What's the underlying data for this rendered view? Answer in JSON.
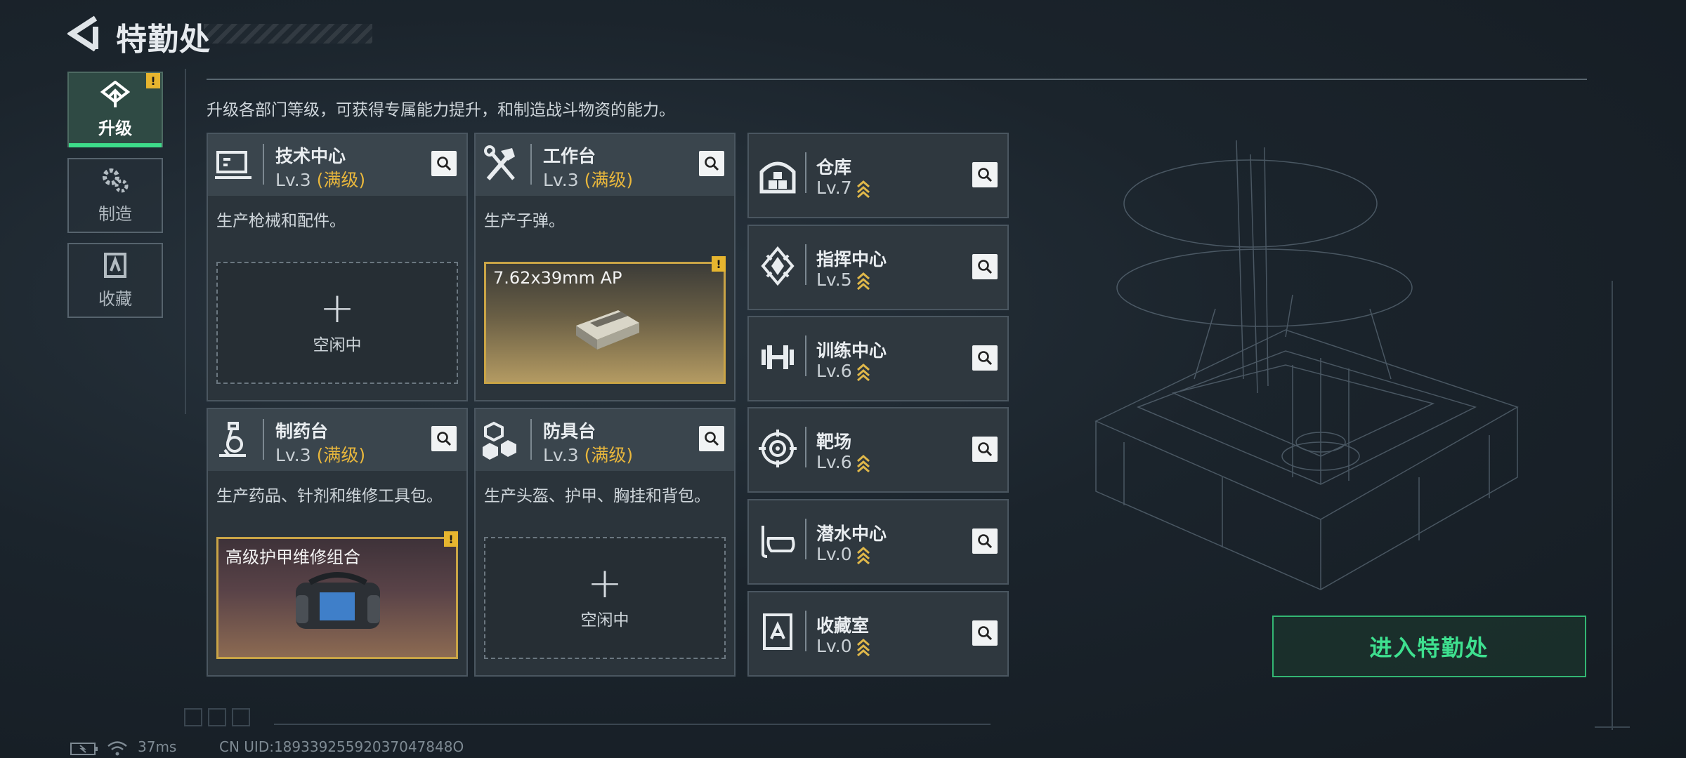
{
  "header": {
    "title": "特勤处"
  },
  "nav": {
    "items": [
      {
        "label": "升级",
        "icon": "upgrade-icon",
        "active": true,
        "alert": "!"
      },
      {
        "label": "制造",
        "icon": "gears-icon",
        "active": false
      },
      {
        "label": "收藏",
        "icon": "collection-icon",
        "active": false
      }
    ]
  },
  "intro": "升级各部门等级，可获得专属能力提升，和制造战斗物资的能力。",
  "workshops": [
    {
      "name": "技术中心",
      "level": "Lv.3",
      "max_label": "(满级)",
      "desc": "生产枪械和配件。",
      "slot": {
        "state": "idle",
        "plus": "+",
        "label": "空闲中"
      }
    },
    {
      "name": "工作台",
      "level": "Lv.3",
      "max_label": "(满级)",
      "desc": "生产子弹。",
      "slot": {
        "state": "item",
        "label": "7.62x39mm AP",
        "alert": "!"
      }
    },
    {
      "name": "制药台",
      "level": "Lv.3",
      "max_label": "(满级)",
      "desc": "生产药品、针剂和维修工具包。",
      "slot": {
        "state": "item",
        "label": "高级护甲维修组合",
        "alert": "!"
      }
    },
    {
      "name": "防具台",
      "level": "Lv.3",
      "max_label": "(满级)",
      "desc": "生产头盔、护甲、胸挂和背包。",
      "slot": {
        "state": "idle",
        "plus": "+",
        "label": "空闲中"
      }
    }
  ],
  "facilities": [
    {
      "name": "仓库",
      "level": "Lv.7",
      "icon": "warehouse-icon"
    },
    {
      "name": "指挥中心",
      "level": "Lv.5",
      "icon": "command-icon"
    },
    {
      "name": "训练中心",
      "level": "Lv.6",
      "icon": "dumbbell-icon"
    },
    {
      "name": "靶场",
      "level": "Lv.6",
      "icon": "target-icon"
    },
    {
      "name": "潜水中心",
      "level": "Lv.0",
      "icon": "diving-mask-icon"
    },
    {
      "name": "收藏室",
      "level": "Lv.0",
      "icon": "collection-room-icon"
    }
  ],
  "enter_button": "进入特勤处",
  "footer": {
    "ping": "37ms",
    "uid": "CN UID:18933925592037047848O"
  },
  "colors": {
    "accent_green": "#3ddc8a",
    "max_gold": "#e9b73c",
    "alert_yellow": "#e6b52f"
  }
}
